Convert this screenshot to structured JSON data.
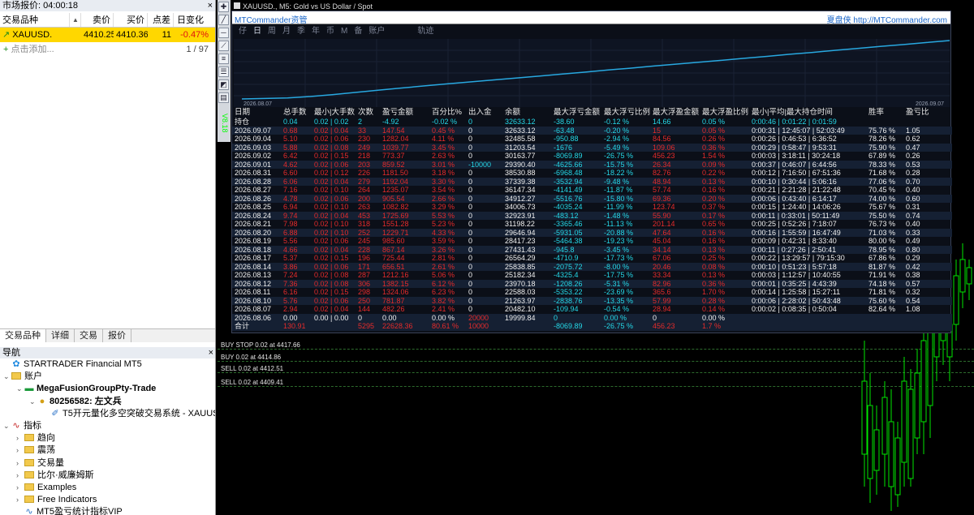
{
  "market": {
    "title": "市场报价: 04:00:18",
    "close": "×",
    "cols": [
      "交易品种",
      "卖价",
      "买价",
      "点差",
      "日变化"
    ],
    "rows": [
      {
        "symbol": "XAUUSD.",
        "bid": "4410.25",
        "ask": "4410.36",
        "spread": "11",
        "change": "-0.47%"
      }
    ],
    "add_label": "点击添加...",
    "count": "1 / 97",
    "tabs": [
      "交易品种",
      "详细",
      "交易",
      "报价"
    ]
  },
  "nav": {
    "title": "导航",
    "close": "×",
    "items": [
      {
        "t": "STARTRADER Financial MT5",
        "lvl": 0,
        "icon": "logo-icon"
      },
      {
        "t": "账户",
        "lvl": 0,
        "icon": "folder-icon",
        "tw": "⌄"
      },
      {
        "t": "MegaFusionGroupPty-Trade",
        "lvl": 1,
        "icon": "server-icon",
        "tw": "⌄"
      },
      {
        "t": "80256582: 左文兵",
        "lvl": 2,
        "icon": "user-icon",
        "tw": "⌄"
      },
      {
        "t": "T5开元量化多空突破交易系统 - XAUUSD.,M",
        "lvl": 3,
        "icon": "ea-icon"
      },
      {
        "t": "指标",
        "lvl": 0,
        "icon": "indicator-icon",
        "tw": "⌄"
      },
      {
        "t": "趋向",
        "lvl": 1,
        "icon": "folder-icon",
        "tw": "›"
      },
      {
        "t": "震荡",
        "lvl": 1,
        "icon": "folder-icon",
        "tw": "›"
      },
      {
        "t": "交易量",
        "lvl": 1,
        "icon": "folder-icon",
        "tw": "›"
      },
      {
        "t": "比尔·威廉姆斯",
        "lvl": 1,
        "icon": "folder-icon",
        "tw": "›"
      },
      {
        "t": "Examples",
        "lvl": 1,
        "icon": "folder-icon",
        "tw": "›"
      },
      {
        "t": "Free Indicators",
        "lvl": 1,
        "icon": "folder-icon",
        "tw": "›"
      },
      {
        "t": "MT5盈亏统计指标VIP",
        "lvl": 1,
        "icon": "indicator-file-icon"
      }
    ]
  },
  "chart": {
    "title": "XAUUSD., M5:  Gold vs US Dollar / Spot",
    "vertical_text": "V8.18",
    "orders": [
      {
        "label": "BUY STOP 0.02 at 4417.66"
      },
      {
        "label": "BUY 0.02 at 4414.86"
      },
      {
        "label": "SELL 0.02 at 4412.51"
      },
      {
        "label": "SELL 0.02 at 4409.41"
      }
    ]
  },
  "dialog": {
    "title": "MTCommander资管",
    "right": "夏盘侠 http://MTCommander.com",
    "tabs": [
      "仔",
      "日",
      "周",
      "月",
      "季",
      "年",
      "币",
      "M",
      "备",
      "账户",
      "",
      "轨迹"
    ],
    "graph_start": "2026.08.07",
    "graph_end": "2026.09.07",
    "equity_curve": [
      0,
      0.3,
      0.6,
      1.4,
      2.5,
      3.8,
      5.1,
      6.3,
      7.5,
      8.7,
      9.8,
      10.9,
      12,
      13.1,
      14.3,
      15.4,
      16.6,
      17.7,
      18.9,
      20,
      21.1,
      22.2,
      23.4,
      24.5,
      25.7,
      26.8,
      28,
      29.1,
      30.3,
      31.3,
      32.5,
      33.6
    ],
    "headers": [
      "日期",
      "总手数",
      "最小|大手数",
      "次数",
      "盈亏金额",
      "百分比%",
      "出入金",
      "余额",
      "最大浮亏金额",
      "最大浮亏比例",
      "最大浮盈金额",
      "最大浮盈比例",
      "最小|平均|最大持仓时间",
      "胜率",
      "盈亏比"
    ],
    "hold": {
      "c": [
        "持仓",
        "0.04",
        "0.02 | 0.02",
        "2",
        "-4.92",
        "-0.02 %",
        "0",
        "32633.12",
        "-38.60",
        "-0.12 %",
        "14.66",
        "0.05 %",
        "0:00:46 | 0:01:22 | 0:01:59",
        "",
        ""
      ]
    },
    "rows": [
      [
        "2026.09.07",
        "0.68",
        "0.02 | 0.04",
        "33",
        "147.54",
        "0.45 %",
        "0",
        "32633.12",
        "-63.48",
        "-0.20 %",
        "15",
        "0.05 %",
        "0:00:31 | 12:45:07 | 52:03:49",
        "75.76 %",
        "1.05"
      ],
      [
        "2026.09.04",
        "5.10",
        "0.02 | 0.06",
        "230",
        "1282.04",
        "4.11 %",
        "0",
        "32485.58",
        "-950.88",
        "-2.94 %",
        "84.56",
        "0.26 %",
        "0:00:26 | 0:46:53 | 6:36:52",
        "78.26 %",
        "0.62"
      ],
      [
        "2026.09.03",
        "5.88",
        "0.02 | 0.08",
        "249",
        "1039.77",
        "3.45 %",
        "0",
        "31203.54",
        "-1676",
        "-5.49 %",
        "109.06",
        "0.36 %",
        "0:00:29 | 0:58:47 | 9:53:31",
        "75.90 %",
        "0.47"
      ],
      [
        "2026.09.02",
        "6.42",
        "0.02 | 0.15",
        "218",
        "773.37",
        "2.63 %",
        "0",
        "30163.77",
        "-8069.89",
        "-26.75 %",
        "456.23",
        "1.54 %",
        "0:00:03 | 3:18:11 | 30:24:18",
        "67.89 %",
        "0.26"
      ],
      [
        "2026.09.01",
        "4.62",
        "0.02 | 0.06",
        "203",
        "859.52",
        "3.01 %",
        "-10000",
        "29390.40",
        "-4625.66",
        "-15.75 %",
        "26.34",
        "0.09 %",
        "0:00:37 | 0:46:07 | 6:44:56",
        "78.33 %",
        "0.53"
      ],
      [
        "2026.08.31",
        "6.60",
        "0.02 | 0.12",
        "226",
        "1181.50",
        "3.18 %",
        "0",
        "38530.88",
        "-6968.48",
        "-18.22 %",
        "82.76",
        "0.22 %",
        "0:00:12 | 7:16:50 | 67:51:36",
        "71.68 %",
        "0.28"
      ],
      [
        "2026.08.28",
        "6.06",
        "0.02 | 0.04",
        "279",
        "1192.04",
        "3.30 %",
        "0",
        "37339.38",
        "-3532.94",
        "-9.48 %",
        "48.94",
        "0.13 %",
        "0:00:10 | 0:30:44 | 5:06:16",
        "77.06 %",
        "0.70"
      ],
      [
        "2026.08.27",
        "7.16",
        "0.02 | 0.10",
        "264",
        "1235.07",
        "3.54 %",
        "0",
        "36147.34",
        "-4141.49",
        "-11.87 %",
        "57.74",
        "0.16 %",
        "0:00:21 | 2:21:28 | 21:22:48",
        "70.45 %",
        "0.40"
      ],
      [
        "2026.08.26",
        "4.78",
        "0.02 | 0.06",
        "200",
        "905.54",
        "2.66 %",
        "0",
        "34912.27",
        "-5516.76",
        "-15.80 %",
        "69.36",
        "0.20 %",
        "0:00:06 | 0:43:40 | 6:14:17",
        "74.00 %",
        "0.60"
      ],
      [
        "2026.08.25",
        "6.94",
        "0.02 | 0.10",
        "263",
        "1082.82",
        "3.29 %",
        "0",
        "34006.73",
        "-4035.24",
        "-11.99 %",
        "123.74",
        "0.37 %",
        "0:00:15 | 1:24:40 | 14:06:26",
        "75.67 %",
        "0.31"
      ],
      [
        "2026.08.24",
        "9.74",
        "0.02 | 0.04",
        "453",
        "1725.69",
        "5.53 %",
        "0",
        "32923.91",
        "-483.12",
        "-1.48 %",
        "55.90",
        "0.17 %",
        "0:00:11 | 0:33:01 | 50:11:49",
        "75.50 %",
        "0.74"
      ],
      [
        "2026.08.21",
        "7.98",
        "0.02 | 0.10",
        "318",
        "1551.28",
        "5.23 %",
        "0",
        "31198.22",
        "-3365.46",
        "-11.13 %",
        "201.14",
        "0.65 %",
        "0:00:25 | 0:52:26 | 7:18:07",
        "76.73 %",
        "0.40"
      ],
      [
        "2026.08.20",
        "6.88",
        "0.02 | 0.10",
        "252",
        "1229.71",
        "4.33 %",
        "0",
        "29646.94",
        "-5931.05",
        "-20.88 %",
        "47.64",
        "0.16 %",
        "0:00:16 | 1:55:59 | 16:47:49",
        "71.03 %",
        "0.33"
      ],
      [
        "2026.08.19",
        "5.56",
        "0.02 | 0.06",
        "245",
        "985.60",
        "3.59 %",
        "0",
        "28417.23",
        "-5464.38",
        "-19.23 %",
        "45.04",
        "0.16 %",
        "0:00:09 | 0:42:31 | 8:33:40",
        "80.00 %",
        "0.49"
      ],
      [
        "2026.08.18",
        "4.66",
        "0.02 | 0.04",
        "228",
        "867.14",
        "3.26 %",
        "0",
        "27431.43",
        "-945.8",
        "-3.45 %",
        "34.14",
        "0.13 %",
        "0:00:11 | 0:27:26 | 2:50:41",
        "78.95 %",
        "0.80"
      ],
      [
        "2026.08.17",
        "5.37",
        "0.02 | 0.15",
        "196",
        "725.44",
        "2.81 %",
        "0",
        "26564.29",
        "-4710.9",
        "-17.73 %",
        "67.06",
        "0.25 %",
        "0:00:22 | 13:29:57 | 79:15:30",
        "67.86 %",
        "0.29"
      ],
      [
        "2026.08.14",
        "3.86",
        "0.02 | 0.06",
        "171",
        "656.51",
        "2.61 %",
        "0",
        "25838.85",
        "-2075.72",
        "-8.00 %",
        "20.46",
        "0.08 %",
        "0:00:10 | 0:51:23 | 5:57:18",
        "81.87 %",
        "0.42"
      ],
      [
        "2026.08.13",
        "7.24",
        "0.02 | 0.08",
        "287",
        "1212.16",
        "5.06 %",
        "0",
        "25182.34",
        "-4325.4",
        "-17.75 %",
        "33.34",
        "0.13 %",
        "0:00:03 | 1:12:57 | 10:40:55",
        "71.91 %",
        "0.38"
      ],
      [
        "2026.08.12",
        "7.36",
        "0.02 | 0.08",
        "306",
        "1382.15",
        "6.12 %",
        "0",
        "23970.18",
        "-1208.26",
        "-5.31 %",
        "82.96",
        "0.36 %",
        "0:00:01 | 0:35:25 | 4:43:39",
        "74.18 %",
        "0.57"
      ],
      [
        "2026.08.11",
        "6.16",
        "0.02 | 0.15",
        "298",
        "1324.06",
        "6.23 %",
        "0",
        "22588.03",
        "-5353.22",
        "-23.69 %",
        "365.6",
        "1.70 %",
        "0:00:14 | 1:25:58 | 15:27:11",
        "71.81 %",
        "0.32"
      ],
      [
        "2026.08.10",
        "5.76",
        "0.02 | 0.06",
        "250",
        "781.87",
        "3.82 %",
        "0",
        "21263.97",
        "-2838.76",
        "-13.35 %",
        "57.99",
        "0.28 %",
        "0:00:06 | 2:28:02 | 50:43:48",
        "75.60 %",
        "0.54"
      ],
      [
        "2026.08.07",
        "2.94",
        "0.02 | 0.04",
        "144",
        "482.26",
        "2.41 %",
        "0",
        "20482.10",
        "-109.94",
        "-0.54 %",
        "28.94",
        "0.14 %",
        "0:00:02 | 0:08:35 | 0:50:04",
        "82.64 %",
        "1.08"
      ],
      [
        "2026.08.06",
        "0.00",
        "0.00 | 0.00",
        "0",
        "0.00",
        "0.00 %",
        "20000",
        "19999.84",
        "0",
        "0.00 %",
        "0",
        "0.00 %",
        "",
        "",
        ""
      ]
    ],
    "total": [
      "合计",
      "130.91",
      "",
      "5295",
      "22628.36",
      "80.61 %",
      "10000",
      "",
      "-8069.89",
      "-26.75 %",
      "456.23",
      "1.7 %",
      "",
      "",
      ""
    ]
  }
}
